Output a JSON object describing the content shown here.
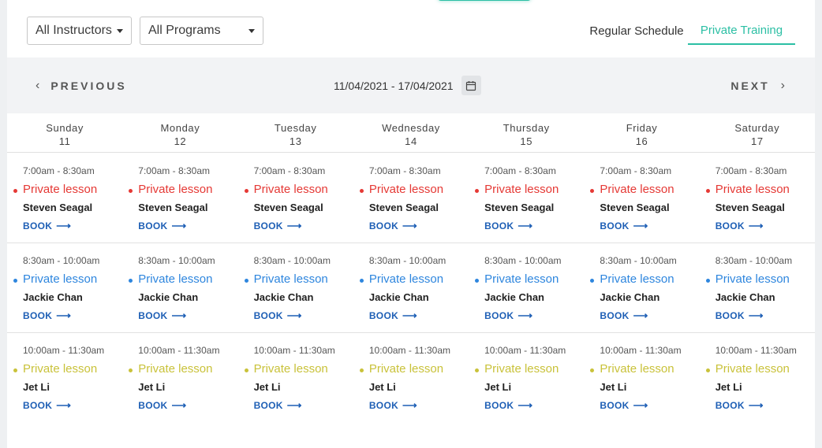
{
  "filters": {
    "instructors": "All Instructors",
    "programs": "All Programs"
  },
  "tabs": {
    "regular": "Regular Schedule",
    "private": "Private Training"
  },
  "nav": {
    "previous": "PREVIOUS",
    "next": "NEXT",
    "date_range": "11/04/2021 - 17/04/2021"
  },
  "days": [
    {
      "name": "Sunday",
      "date": "11"
    },
    {
      "name": "Monday",
      "date": "12"
    },
    {
      "name": "Tuesday",
      "date": "13"
    },
    {
      "name": "Wednesday",
      "date": "14"
    },
    {
      "name": "Thursday",
      "date": "15"
    },
    {
      "name": "Friday",
      "date": "16"
    },
    {
      "name": "Saturday",
      "date": "17"
    }
  ],
  "slots": [
    {
      "time": "7:00am - 8:30am",
      "title": "Private lesson",
      "instructor": "Steven Seagal",
      "color": "#e53935"
    },
    {
      "time": "8:30am - 10:00am",
      "title": "Private lesson",
      "instructor": "Jackie Chan",
      "color": "#2e86de"
    },
    {
      "time": "10:00am - 11:30am",
      "title": "Private lesson",
      "instructor": "Jet Li",
      "color": "#c9c23a"
    }
  ],
  "book_label": "BOOK",
  "colors": {
    "accent": "#2bbfa4",
    "book_link": "#1e5fb5"
  }
}
